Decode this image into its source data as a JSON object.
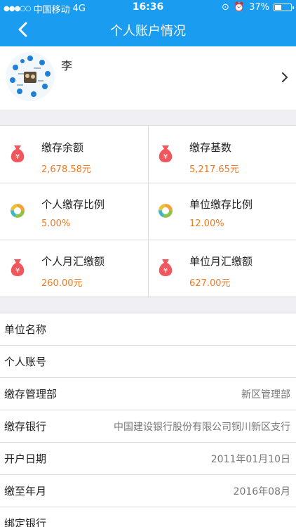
{
  "status_bar": {
    "carrier": "中国移动",
    "network": "4G",
    "time": "16:36",
    "battery": "37%"
  },
  "nav": {
    "title": "个人账户情况"
  },
  "profile": {
    "name": "李"
  },
  "summary": [
    {
      "label": "缴存余额",
      "value": "2,678.58元",
      "icon": "money-bag-icon"
    },
    {
      "label": "缴存基数",
      "value": "5,217.65元",
      "icon": "money-bag-icon"
    },
    {
      "label": "个人缴存比例",
      "value": "5.00%",
      "icon": "donut-chart-icon"
    },
    {
      "label": "单位缴存比例",
      "value": "12.00%",
      "icon": "donut-chart-icon"
    },
    {
      "label": "个人月汇缴额",
      "value": "260.00元",
      "icon": "money-bag-icon"
    },
    {
      "label": "单位月汇缴额",
      "value": "627.00元",
      "icon": "money-bag-icon"
    }
  ],
  "details": [
    {
      "label": "单位名称",
      "value": ""
    },
    {
      "label": "个人账号",
      "value": ""
    },
    {
      "label": "缴存管理部",
      "value": "新区管理部"
    },
    {
      "label": "缴存银行",
      "value": "中国建设银行股份有限公司铜川新区支行"
    },
    {
      "label": "开户日期",
      "value": "2011年01月10日"
    },
    {
      "label": "缴至年月",
      "value": "2016年08月"
    },
    {
      "label": "绑定银行",
      "value": ""
    }
  ],
  "colors": {
    "nav": "#1a9cf0",
    "accent": "#f07a21",
    "bag": "#f0565b"
  }
}
